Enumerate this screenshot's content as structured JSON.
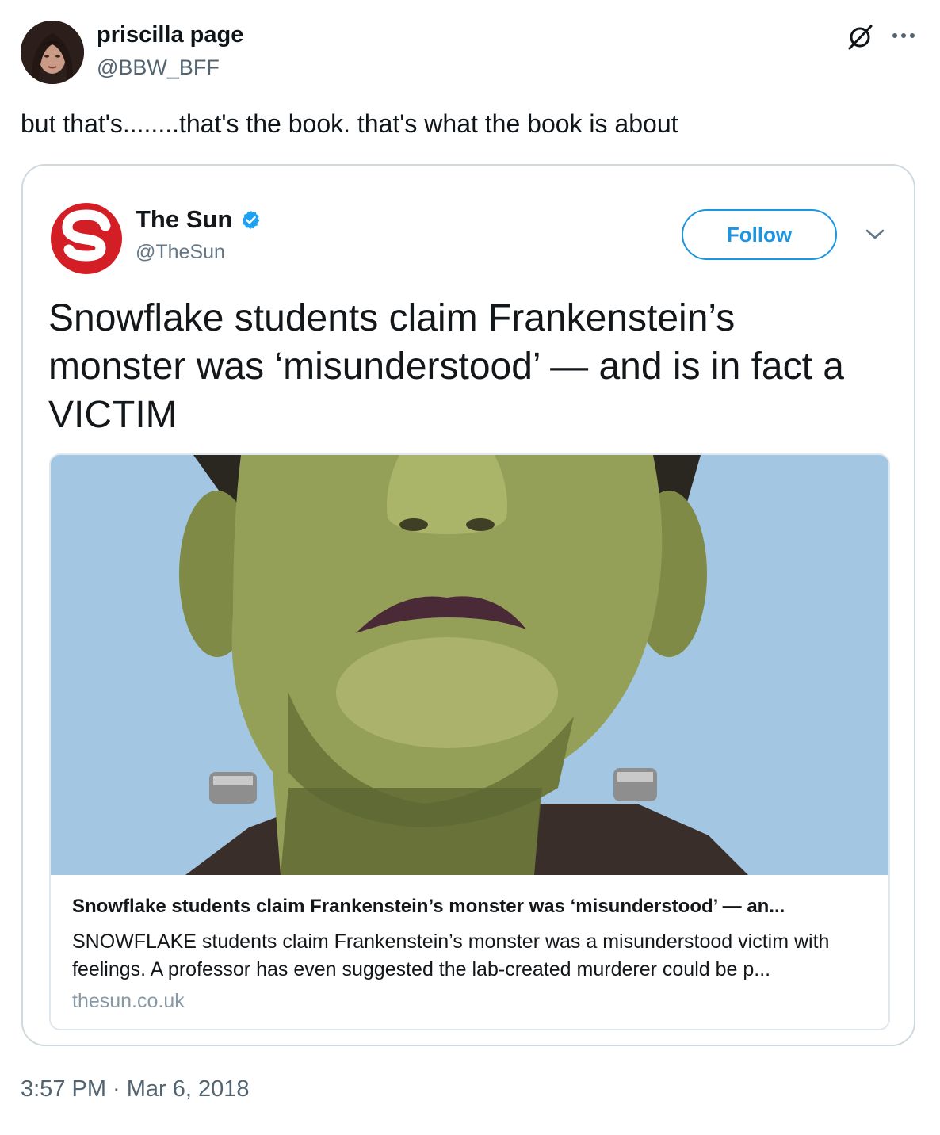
{
  "tweet": {
    "author_name": "priscilla page",
    "author_handle": "@BBW_BFF",
    "text": "but that's........that's the book. that's what the book is about",
    "timestamp": "3:57 PM · Mar 6, 2018"
  },
  "quoted": {
    "author_name": "The Sun",
    "author_handle": "@TheSun",
    "follow_label": "Follow",
    "text": "Snowflake students claim Frankenstein’s monster was ‘misunderstood’ — and is in fact a VICTIM",
    "link_card": {
      "title": "Snowflake students claim Frankenstein’s monster was ‘misunderstood’ — an...",
      "description": "SNOWFLAKE students claim Frankenstein’s monster was a misunderstood victim with feelings. A professor has even suggested the lab-created murderer could be p...",
      "domain": "thesun.co.uk"
    }
  },
  "colors": {
    "link_blue": "#1b95e0",
    "verified_blue": "#1da1f2",
    "sun_red": "#d41e26",
    "secondary_text": "#536471"
  },
  "icons": [
    "grok-icon",
    "more-icon",
    "verified-icon",
    "chevron-down-icon",
    "sun-logo"
  ]
}
